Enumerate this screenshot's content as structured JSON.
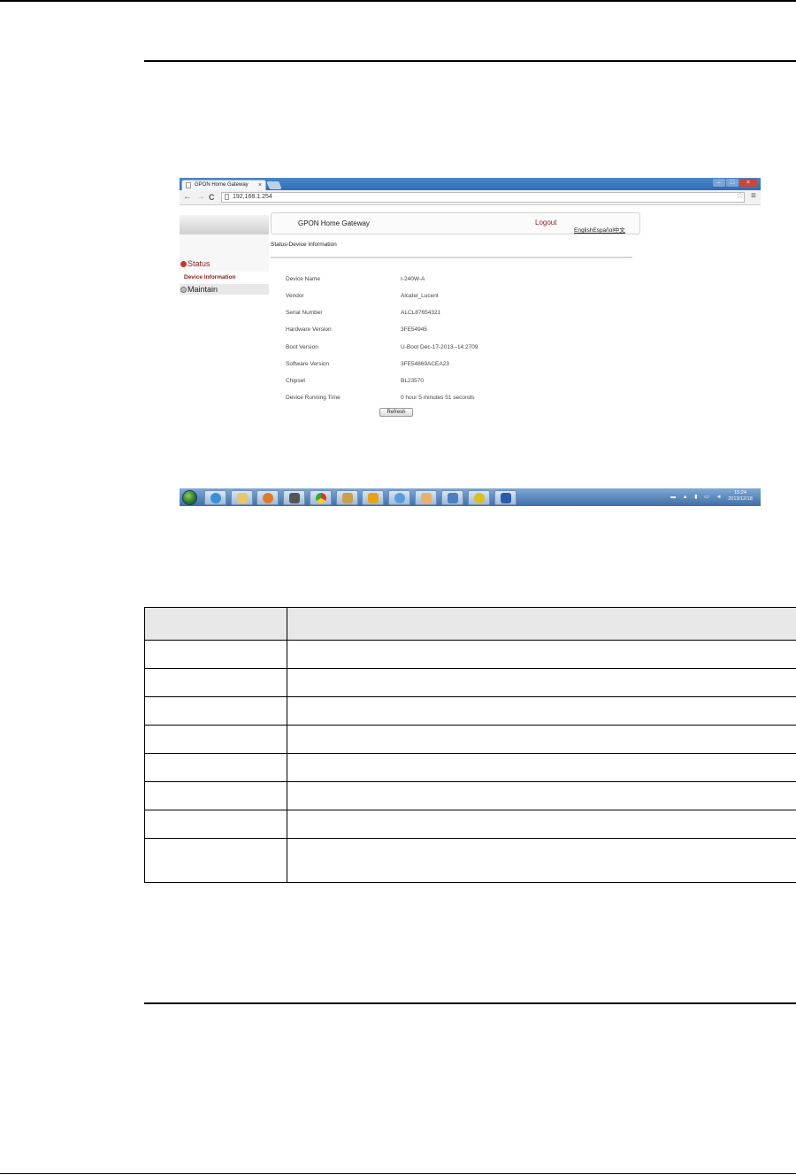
{
  "browser": {
    "tab_title": "GPON Home Gateway",
    "tab_close": "×",
    "url": "192.168.1.254",
    "nav_back": "←",
    "nav_forward": "→",
    "nav_reload": "C",
    "bookmark_star": "☆",
    "menu_glyph": "≡"
  },
  "app": {
    "title": "GPON Home Gateway",
    "logout": "Logout",
    "languages": "EnglishEspañol中文",
    "breadcrumb": "Status›Device Information",
    "nav": {
      "status": "Status",
      "device_information": "Device Information",
      "maintain": "Maintain"
    },
    "device_info": [
      {
        "label": "Device Name",
        "value": "I-240W-A"
      },
      {
        "label": "Vendor",
        "value": "Alcatel_Lucent"
      },
      {
        "label": "Serial Number",
        "value": "ALCL87654321"
      },
      {
        "label": "Hardware Version",
        "value": "3FE54945"
      },
      {
        "label": "Boot Version",
        "value": "U-Boot Dec-17-2013--14:2709"
      },
      {
        "label": "Software Version",
        "value": "3FE54869ACEA23"
      },
      {
        "label": "Chipset",
        "value": "BL23570"
      },
      {
        "label": "Device Running Time",
        "value": "0 hour 5 minutes 51 seconds"
      }
    ],
    "refresh_label": "Refresh"
  },
  "taskbar": {
    "time": "15:24",
    "date": "2013/12/18",
    "tray_icons": "▬ ▲ ▮ ▭ ◄"
  }
}
